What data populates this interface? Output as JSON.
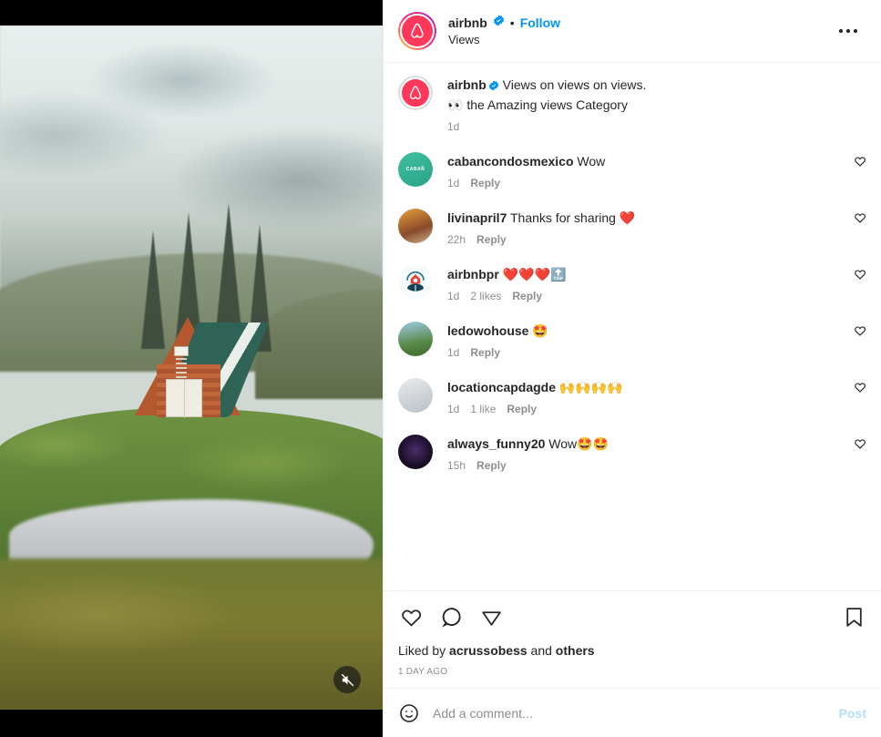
{
  "media": {
    "type": "video",
    "mute_icon": "muted-speaker-icon",
    "alt": "A-frame cabin with red wood siding and green roof on a mossy green hillside beside a stream, pine trees and overcast sky"
  },
  "header": {
    "avatar_name": "airbnb-avatar",
    "username": "airbnb",
    "verified": true,
    "separator": "•",
    "follow_label": "Follow",
    "subtitle": "Views",
    "more_label": "•••"
  },
  "caption": {
    "avatar_name": "airbnb-avatar",
    "username": "airbnb",
    "verified": true,
    "line1": "Views on views on views.",
    "line2": "👀 the Amazing views Category",
    "time": "1d"
  },
  "comments": [
    {
      "avatar": "cabancondosmexico-avatar",
      "avatar_text": "CABAÑ",
      "username": "cabancondosmexico",
      "text": "Wow",
      "time": "1d",
      "likes": "",
      "reply": "Reply"
    },
    {
      "avatar": "livinapril7-avatar",
      "avatar_text": "",
      "username": "livinapril7",
      "text": "Thanks for sharing ❤️",
      "time": "22h",
      "likes": "",
      "reply": "Reply"
    },
    {
      "avatar": "airbnbpr-avatar",
      "avatar_text": "",
      "username": "airbnbpr",
      "text": "❤️❤️❤️🔝",
      "time": "1d",
      "likes": "2 likes",
      "reply": "Reply"
    },
    {
      "avatar": "ledowohouse-avatar",
      "avatar_text": "",
      "username": "ledowohouse",
      "text": "🤩",
      "time": "1d",
      "likes": "",
      "reply": "Reply"
    },
    {
      "avatar": "locationcapdagde-avatar",
      "avatar_text": "",
      "username": "locationcapdagde",
      "text": "🙌🙌🙌🙌",
      "time": "1d",
      "likes": "1 like",
      "reply": "Reply"
    },
    {
      "avatar": "always_funny20-avatar",
      "avatar_text": "",
      "username": "always_funny20",
      "text": "Wow🤩🤩",
      "time": "15h",
      "likes": "",
      "reply": "Reply"
    }
  ],
  "actions": {
    "like_icon": "heart-icon",
    "comment_icon": "speech-bubble-icon",
    "share_icon": "paper-plane-icon",
    "save_icon": "bookmark-icon"
  },
  "likes_line": {
    "prefix": "Liked by ",
    "user": "acrussobess",
    "middle": " and ",
    "suffix": "others"
  },
  "posted_time": "1 DAY AGO",
  "add_comment": {
    "emoji_icon": "smiley-face-icon",
    "placeholder": "Add a comment...",
    "value": "",
    "post_label": "Post"
  },
  "colors": {
    "link_blue": "#0095f6",
    "post_disabled": "#b2dffc",
    "text_primary": "#262626",
    "text_secondary": "#8e8e8e",
    "airbnb_pink": "#ff385c"
  }
}
